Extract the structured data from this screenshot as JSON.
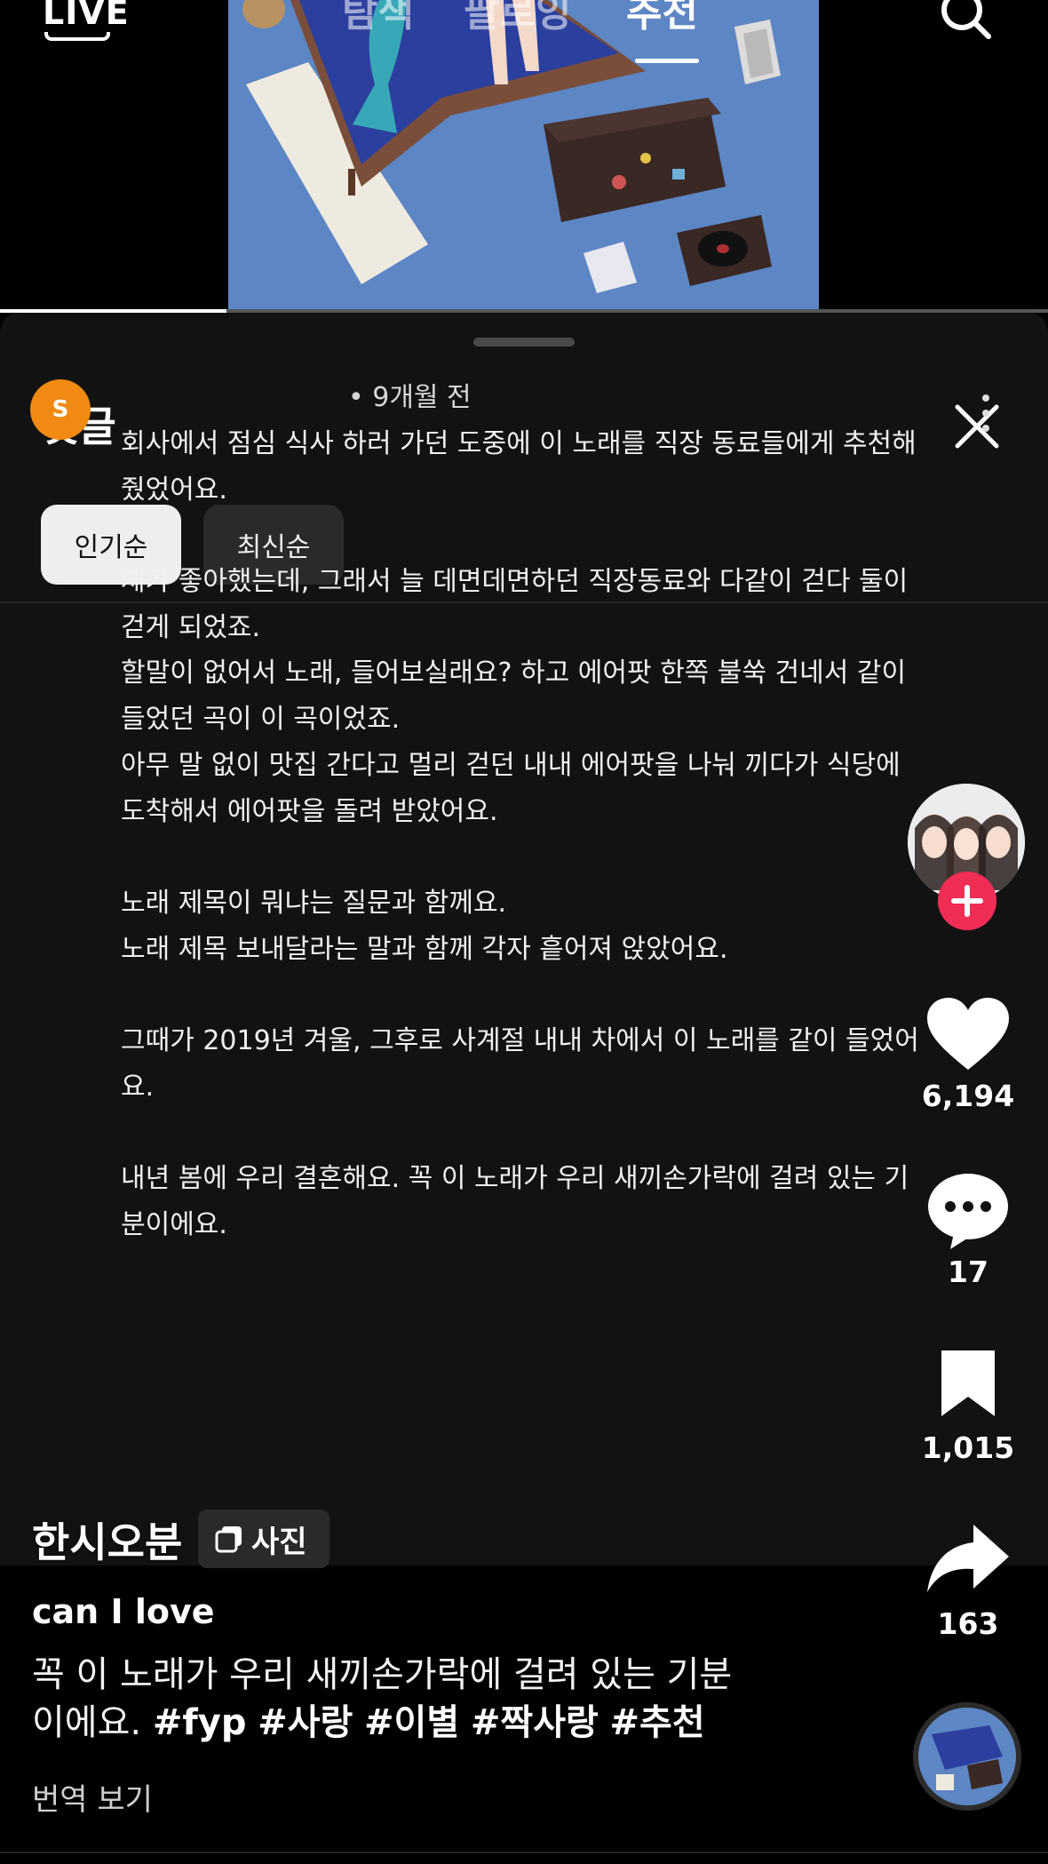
{
  "top_bar": {
    "tabs": [
      {
        "label": "탐색"
      },
      {
        "label": "팔로잉"
      },
      {
        "label": "추천",
        "active": true
      }
    ],
    "live_label": "LIVE"
  },
  "comments_sheet": {
    "title": "댓글",
    "sort_buttons": [
      {
        "label": "인기순",
        "selected": true
      },
      {
        "label": "최신순",
        "selected": false
      }
    ],
    "comment": {
      "avatar_letter": "S",
      "time": "• 9개월 전",
      "lines": [
        "회사에서 점심 식사 하러 가던 도중에 이 노래를 직장 동료들에게 추천해",
        "줬었어요.",
        "",
        "제가 좋아했는데, 그래서 늘 데면데면하던 직장동료와 다같이 걷다 둘이",
        "걷게 되었죠.",
        "할말이 없어서 노래, 들어보실래요? 하고 에어팟 한쪽 불쑥 건네서 같이",
        "들었던 곡이 이 곡이었죠.",
        "아무 말 없이 맛집 간다고 멀리 걷던 내내 에어팟을 나눠 끼다가 식당에",
        "도착해서 에어팟을 돌려 받았어요.",
        "",
        "노래 제목이 뭐냐는 질문과 함께요.",
        "노래 제목 보내달라는 말과 함께 각자 흩어져 앉았어요.",
        "",
        "그때가 2019년 겨울, 그후로 사계절 내내 차에서 이 노래를 같이 들었어",
        "요.",
        "",
        "내년 봄에 우리 결혼해요. 꼭 이 노래가 우리 새끼손가락에 걸려 있는 기",
        "분이에요."
      ]
    }
  },
  "actions": {
    "likes": "6,194",
    "comments": "17",
    "bookmarks": "1,015",
    "shares": "163"
  },
  "post": {
    "author": "한시오분",
    "photo_badge": "사진",
    "song_title": "can I love",
    "caption_line1": "꼭 이 노래가 우리 새끼손가락에 걸려 있는 기분",
    "caption_line2_text": "이에요.",
    "hashtags": [
      "#fyp",
      "#사랑",
      "#이별",
      "#짝사랑",
      "#추천"
    ],
    "translate": "번역 보기"
  },
  "colors": {
    "sheet_bg": "#121212",
    "avatar": "#f08a12",
    "follow": "#ef2d55",
    "artwork_blue": "#5d86c4"
  }
}
